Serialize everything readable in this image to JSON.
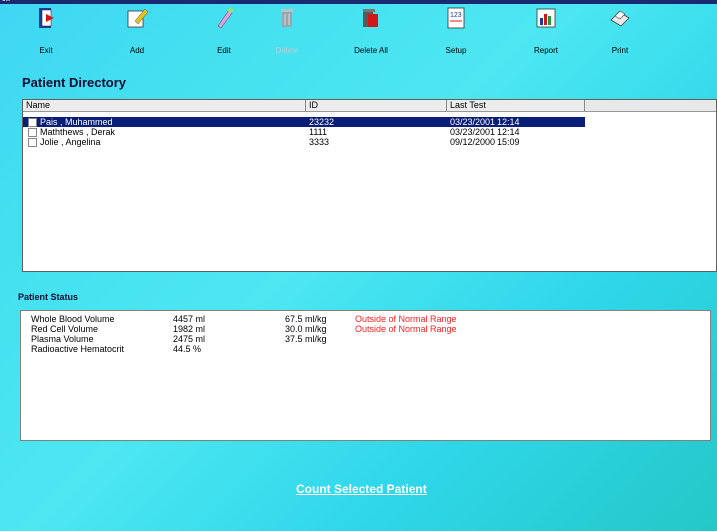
{
  "window": {
    "title": "ott"
  },
  "toolbar": [
    {
      "label": "Exit",
      "icon": "exit-icon"
    },
    {
      "label": "Add",
      "icon": "add-icon"
    },
    {
      "label": "Edit",
      "icon": "edit-icon"
    },
    {
      "label": "Delete",
      "icon": "delete-icon",
      "disabled": true
    },
    {
      "label": "Delete All",
      "icon": "delete-all-icon"
    },
    {
      "label": "Setup",
      "icon": "setup-icon"
    },
    {
      "label": "Report",
      "icon": "report-icon"
    },
    {
      "label": "Print",
      "icon": "print-icon"
    }
  ],
  "patient_directory": {
    "title": "Patient Directory",
    "columns": [
      "Name",
      "ID",
      "Last Test"
    ],
    "rows": [
      {
        "name": "Pais , Muhammed",
        "id": "23232",
        "date": "03/23/2001",
        "time": "12:14",
        "selected": true
      },
      {
        "name": "Maththews , Derak",
        "id": "1111",
        "date": "03/23/2001",
        "time": "12:14",
        "selected": false
      },
      {
        "name": "Jolie , Angelina",
        "id": "3333",
        "date": "09/12/2000",
        "time": "15:09",
        "selected": false
      }
    ]
  },
  "patient_status": {
    "title": "Patient Status",
    "rows": [
      {
        "label": "Whole Blood Volume",
        "value": "4457 ml",
        "per_kg": "67.5 ml/kg",
        "note": "Outside of Normal Range"
      },
      {
        "label": "Red Cell Volume",
        "value": "1982 ml",
        "per_kg": "30.0 ml/kg",
        "note": "Outside of Normal Range"
      },
      {
        "label": "Plasma Volume",
        "value": "2475 ml",
        "per_kg": "37.5 ml/kg",
        "note": ""
      },
      {
        "label": "Radioactive Hematocrit",
        "value": "44.5 %",
        "per_kg": "",
        "note": ""
      }
    ]
  },
  "actions": {
    "count_label": "Count Selected Patient"
  },
  "colors": {
    "selection": "#0a1e78",
    "warning": "#ff2020",
    "background": "#44e0f0"
  }
}
